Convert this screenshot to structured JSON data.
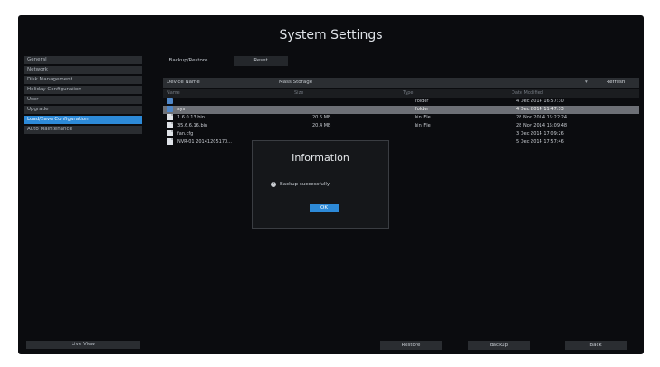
{
  "title": "System Settings",
  "sidebar": {
    "items": [
      {
        "label": "General"
      },
      {
        "label": "Network"
      },
      {
        "label": "Disk Management"
      },
      {
        "label": "Holiday Configuration"
      },
      {
        "label": "User"
      },
      {
        "label": "Upgrade"
      },
      {
        "label": "Load/Save Configuration"
      },
      {
        "label": "Auto Maintenance"
      }
    ],
    "active_index": 6,
    "live_view_label": "Live View"
  },
  "tabs": [
    {
      "label": "Backup/Restore"
    },
    {
      "label": "Reset"
    }
  ],
  "device": {
    "label": "Device Name",
    "value": "Mass Storage",
    "refresh_label": "Refresh"
  },
  "table": {
    "columns": [
      "Name",
      "Size",
      "Type",
      "Date Modified"
    ],
    "rows": [
      {
        "name": "",
        "size": "",
        "type": "Folder",
        "date": "4 Dec 2014 16:57:30",
        "icon": "folder-icon"
      },
      {
        "name": "sys",
        "size": "",
        "type": "Folder",
        "date": "4 Dec 2014 11:47:33",
        "icon": "folder-icon"
      },
      {
        "name": "1.6.0.13.bin",
        "size": "20.5 MB",
        "type": "bin File",
        "date": "28 Nov 2014 15:22:24",
        "icon": "file-icon"
      },
      {
        "name": "35.6.6.16.bin",
        "size": "20.4 MB",
        "type": "bin File",
        "date": "28 Nov 2014 15:09:48",
        "icon": "file-icon"
      },
      {
        "name": "fan.cfg",
        "size": "",
        "type": "",
        "date": "3 Dec 2014 17:09:26",
        "icon": "file-icon"
      },
      {
        "name": "NVR-01 20141205170...",
        "size": "",
        "type": "",
        "date": "5 Dec 2014 17:57:46",
        "icon": "file-icon"
      }
    ],
    "selected_index": 1
  },
  "dialog": {
    "title": "Information",
    "message": "Backup successfully.",
    "ok_label": "OK"
  },
  "footer": {
    "restore_label": "Restore",
    "backup_label": "Backup",
    "back_label": "Back"
  },
  "colors": {
    "background": "#0b0c0f",
    "accent": "#2d8ad8",
    "selected_row": "#6d7076"
  }
}
